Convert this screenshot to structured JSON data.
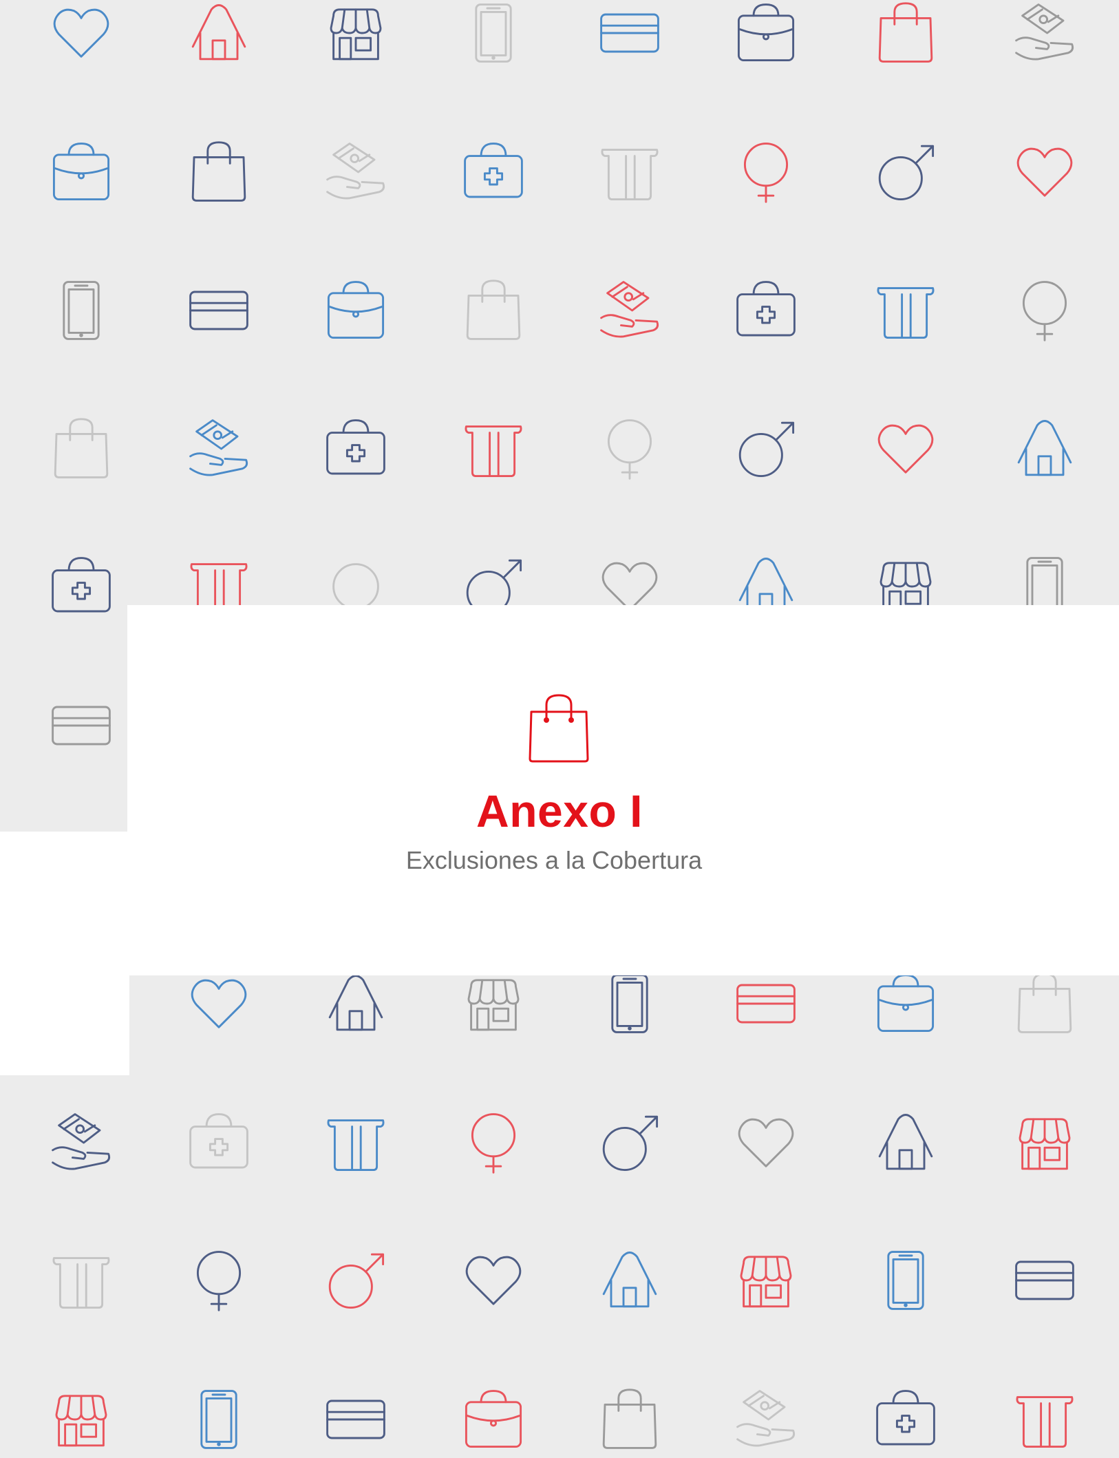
{
  "document": {
    "title": "Anexo I",
    "subtitle": "Exclusiones a la Cobertura",
    "title_icon": "shopping-bag-icon"
  },
  "colors": {
    "background": "#ececec",
    "panel": "#ffffff",
    "title": "#e3121a",
    "subtitle": "#6f6f6f",
    "blue": "#4a8ac8",
    "navy": "#4e5d85",
    "red": "#e9545c",
    "gray": "#9a9a9a",
    "light": "#c4c4c4"
  },
  "pattern": {
    "rows": [
      [
        [
          "heart",
          "blue"
        ],
        [
          "house",
          "red"
        ],
        [
          "shop",
          "navy"
        ],
        [
          "phone",
          "light"
        ],
        [
          "card",
          "blue"
        ],
        [
          "briefcase",
          "navy"
        ],
        [
          "bag",
          "red"
        ],
        [
          "cash-hand",
          "gray"
        ]
      ],
      [
        [
          "briefcase",
          "blue"
        ],
        [
          "bag",
          "navy"
        ],
        [
          "cash-hand",
          "light"
        ],
        [
          "medkit",
          "blue"
        ],
        [
          "atm-card",
          "light"
        ],
        [
          "female",
          "red"
        ],
        [
          "male",
          "navy"
        ],
        [
          "heart",
          "red"
        ]
      ],
      [
        [
          "phone",
          "gray"
        ],
        [
          "card",
          "navy"
        ],
        [
          "briefcase",
          "blue"
        ],
        [
          "bag",
          "light"
        ],
        [
          "cash-hand",
          "red"
        ],
        [
          "medkit",
          "navy"
        ],
        [
          "atm-card",
          "blue"
        ],
        [
          "female",
          "gray"
        ]
      ],
      [
        [
          "bag",
          "light"
        ],
        [
          "cash-hand",
          "blue"
        ],
        [
          "medkit",
          "navy"
        ],
        [
          "atm-card",
          "red"
        ],
        [
          "female",
          "light"
        ],
        [
          "male",
          "navy"
        ],
        [
          "heart",
          "red"
        ],
        [
          "house",
          "blue"
        ]
      ],
      [
        [
          "medkit",
          "navy"
        ],
        [
          "atm-card",
          "red"
        ],
        [
          "circle",
          "light"
        ],
        [
          "male",
          "navy"
        ],
        [
          "heart",
          "gray"
        ],
        [
          "house",
          "blue"
        ],
        [
          "shop",
          "navy"
        ],
        [
          "phone",
          "gray"
        ]
      ],
      [
        [
          "card",
          "gray"
        ],
        null,
        null,
        null,
        null,
        null,
        null,
        null
      ],
      [
        null,
        [
          "heart",
          "blue"
        ],
        [
          "house",
          "navy"
        ],
        [
          "shop",
          "gray"
        ],
        [
          "phone",
          "navy"
        ],
        [
          "card",
          "red"
        ],
        [
          "briefcase",
          "blue"
        ],
        [
          "bag",
          "light"
        ]
      ],
      [
        [
          "cash-hand",
          "navy"
        ],
        [
          "medkit",
          "light"
        ],
        [
          "atm-card",
          "blue"
        ],
        [
          "female",
          "red"
        ],
        [
          "male",
          "navy"
        ],
        [
          "heart",
          "gray"
        ],
        [
          "house",
          "navy"
        ],
        [
          "shop",
          "red"
        ]
      ],
      [
        [
          "atm-card",
          "light"
        ],
        [
          "female",
          "navy"
        ],
        [
          "male",
          "red"
        ],
        [
          "heart",
          "navy"
        ],
        [
          "house",
          "blue"
        ],
        [
          "shop",
          "red"
        ],
        [
          "phone",
          "blue"
        ],
        [
          "card",
          "navy"
        ]
      ],
      [
        [
          "shop",
          "red"
        ],
        [
          "phone",
          "blue"
        ],
        [
          "card",
          "navy"
        ],
        [
          "briefcase",
          "red"
        ],
        [
          "bag",
          "gray"
        ],
        [
          "cash-hand",
          "light"
        ],
        [
          "medkit",
          "navy"
        ],
        [
          "atm-card",
          "red"
        ]
      ]
    ]
  }
}
